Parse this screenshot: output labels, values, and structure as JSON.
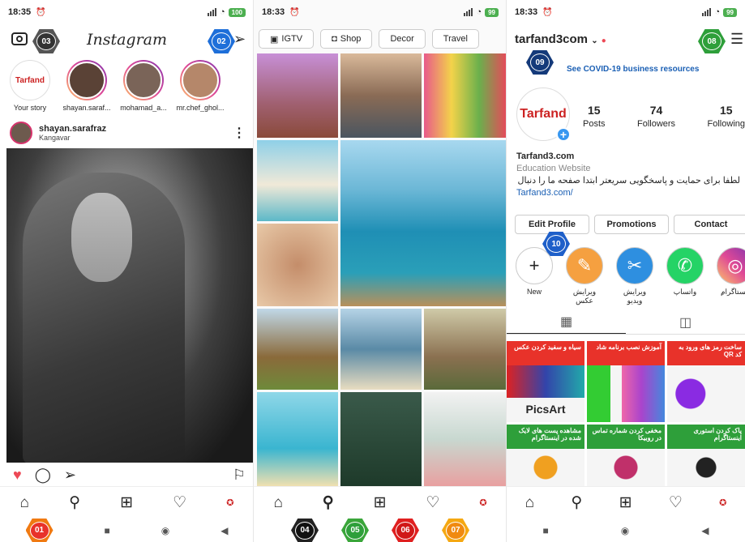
{
  "colors": {
    "accent": "#3897f0",
    "ig_heart": "#ed4956",
    "tile_red": "#e8322a",
    "tile_green": "#2e9f3a"
  },
  "badges": {
    "b01": "01",
    "b02": "02",
    "b03": "03",
    "b04": "04",
    "b05": "05",
    "b06": "06",
    "b07": "07",
    "b08": "08",
    "b09": "09",
    "b10": "10"
  },
  "screen1": {
    "status_time": "18:35",
    "battery": "100",
    "app_title": "Instagram",
    "stories": [
      {
        "label": "Your story"
      },
      {
        "label": "shayan.saraf..."
      },
      {
        "label": "mohamad_a..."
      },
      {
        "label": "mr.chef_ghol..."
      }
    ],
    "story_logo": "Tarfand",
    "post": {
      "username": "shayan.sarafraz",
      "location": "Kangavar"
    }
  },
  "screen2": {
    "status_time": "18:33",
    "battery": "99",
    "chips": [
      "IGTV",
      "Shop",
      "Decor",
      "Travel"
    ]
  },
  "screen3": {
    "status_time": "18:33",
    "battery": "99",
    "username": "tarfand3com",
    "covid_link": "See COVID-19 business resources",
    "logo": "Tarfand",
    "stats": [
      {
        "value": "15",
        "label": "Posts"
      },
      {
        "value": "74",
        "label": "Followers"
      },
      {
        "value": "15",
        "label": "Following"
      }
    ],
    "bio": {
      "name": "Tarfand3.com",
      "category": "Education Website",
      "text": "لطفا برای حمایت و پاسخگویی سریعتر ابتدا صفحه ما را دنبال کنید",
      "link": "Tarfand3.com/"
    },
    "buttons": [
      "Edit Profile",
      "Promotions",
      "Contact"
    ],
    "highlights": [
      {
        "label": "New",
        "icon": "plus-icon"
      },
      {
        "label": "ویرایش عکس",
        "icon": "photo-edit-icon"
      },
      {
        "label": "ویرایش ویدیو",
        "icon": "video-edit-icon"
      },
      {
        "label": "واتساپ",
        "icon": "whatsapp-icon"
      },
      {
        "label": "ِینستاگرام",
        "icon": "instagram-icon"
      }
    ],
    "tiles": [
      {
        "title": "سیاه و سفید کردن عکس",
        "footer": "PicsArt"
      },
      {
        "title": "آموزش نصب برنامه شاد",
        "footer": ""
      },
      {
        "title": "ساخت رمز های ورود به کد QR",
        "footer": ""
      },
      {
        "title": "مشاهده پست های لایک شده در اینستاگرام",
        "footer": ""
      },
      {
        "title": "مخفی کردن شماره تماس در روبیکا",
        "footer": ""
      },
      {
        "title": "پاک کردن استوری اینستاگرام",
        "footer": ""
      }
    ]
  }
}
